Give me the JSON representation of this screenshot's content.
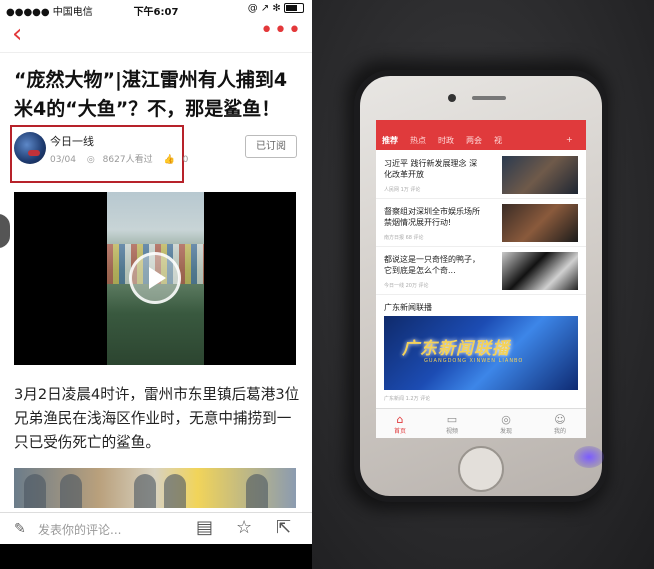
{
  "status_bar": {
    "carrier": "●●●●● 中国电信 ",
    "time": "下午6:07",
    "right": "@ ↗ ✻"
  },
  "nav": {
    "back_icon": "chevron-left-icon",
    "more": "•••"
  },
  "article": {
    "title": "“庞然大物”|湛江雷州有人捕到4米4的“大鱼”？不，那是鲨鱼！",
    "author": "今日一线",
    "date": "03/04",
    "views": "8627人看过",
    "likes": "0",
    "subscribe_label": "已订阅",
    "body": "3月2日凌晨4时许，雷州市东里镇后葛港3位兄弟渔民在浅海区作业时，无意中捕捞到一只已受伤死亡的鲨鱼。",
    "highlight_color": "#b7222a"
  },
  "bottom_bar": {
    "comment_placeholder": "发表你的评论..."
  },
  "photo_phone": {
    "tabs": [
      "推荐",
      "热点",
      "时政",
      "两会",
      "视"
    ],
    "items": [
      {
        "title": "习近平  践行新发展理念 深化改革开放",
        "meta": "人民网 1万 评论"
      },
      {
        "title": "督察组对深圳全市娱乐场所禁烟情况展开行动!",
        "meta": "南方日报 68 评论"
      },
      {
        "title": "都说这是一只奇怪的鸭子，它到底是怎么个奇...",
        "meta": "今日一线 20万 评论"
      }
    ],
    "section_title": "广东新闻联播",
    "banner_title": "广东新闻联播",
    "banner_sub": "GUANGDONG XINWEN LIANBO",
    "banner_meta": "广东新闻  1.2万 评论",
    "bottom_nav": [
      "首页",
      "视频",
      "发现",
      "我的"
    ]
  }
}
